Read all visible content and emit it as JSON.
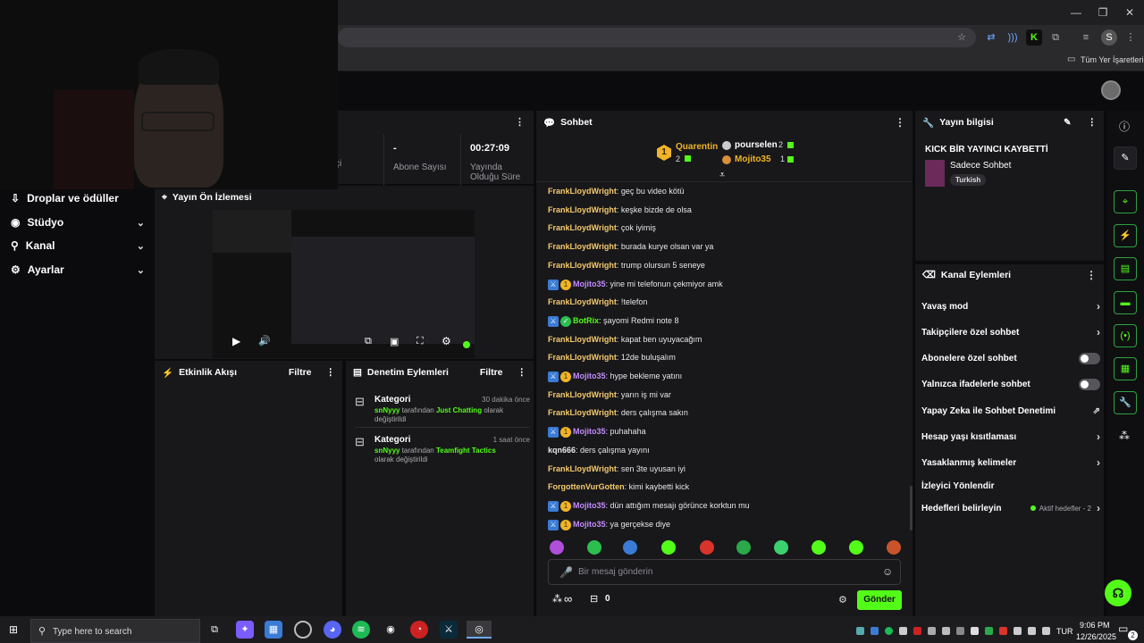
{
  "browser": {
    "bookmarks_label": "Tüm Yer İşaretleri",
    "profile_letter": "S",
    "colors": {
      "bg": "#1f1f22",
      "toolbar": "#2a2a2d"
    }
  },
  "nav": {
    "items": [
      {
        "label": "Droplar ve ödüller",
        "icon": "gift-icon"
      },
      {
        "label": "Stüdyo",
        "icon": "camera-icon"
      },
      {
        "label": "Kanal",
        "icon": "chart-icon"
      },
      {
        "label": "Ayarlar",
        "icon": "gear-icon"
      }
    ]
  },
  "stats": {
    "partial_label": "çi",
    "subs_value": "-",
    "subs_label": "Abone Sayısı",
    "uptime_value": "00:27:09",
    "uptime_label": "Yayında Olduğu Süre"
  },
  "preview": {
    "title": "Yayın Ön İzlemesi"
  },
  "activity": {
    "title": "Etkinlik Akışı",
    "filter": "Filtre"
  },
  "moderation": {
    "title": "Denetim Eylemleri",
    "filter": "Filtre",
    "events": [
      {
        "type": "Kategori",
        "time": "30 dakika önce",
        "user": "snNyyy",
        "middle": "tarafından",
        "category": "Just Chatting",
        "suffix": "olarak değiştirildi"
      },
      {
        "type": "Kategori",
        "time": "1 saat önce",
        "user": "snNyyy",
        "middle": "tarafından",
        "category": "Teamfight Tactics",
        "suffix": "olarak değiştirildi"
      }
    ]
  },
  "chat": {
    "title": "Sohbet",
    "leaders": [
      {
        "rank": "1",
        "name": "Quarentin",
        "count": "2"
      },
      {
        "name": "pourselen",
        "count": "2"
      },
      {
        "name": "Mojito35",
        "count": "1"
      }
    ],
    "messages": [
      {
        "user": "FrankLloydWright",
        "text": "geç bu video kötü",
        "color": "#f5c96b",
        "badges": 0
      },
      {
        "user": "FrankLloydWright",
        "text": "keşke bizde de olsa",
        "color": "#f5c96b",
        "badges": 0
      },
      {
        "user": "FrankLloydWright",
        "text": "çok iyimiş",
        "color": "#f5c96b",
        "badges": 0
      },
      {
        "user": "FrankLloydWright",
        "text": "burada kurye olsan var ya",
        "color": "#f5c96b",
        "badges": 0
      },
      {
        "user": "FrankLloydWright",
        "text": "trump olursun 5 seneye",
        "color": "#f5c96b",
        "badges": 0
      },
      {
        "user": "Mojito35",
        "text": "yine mi telefonun çekmiyor amk",
        "color": "#c38aff",
        "badges": 2
      },
      {
        "user": "FrankLloydWright",
        "text": "!telefon",
        "color": "#f5c96b",
        "badges": 0
      },
      {
        "user": "BotRix",
        "text": "şayomi Redmi note 8",
        "color": "#53fc18",
        "badges": 3
      },
      {
        "user": "FrankLloydWright",
        "text": "kapat ben uyuyacağım",
        "color": "#f5c96b",
        "badges": 0
      },
      {
        "user": "FrankLloydWright",
        "text": "12de buluşalım",
        "color": "#f5c96b",
        "badges": 0
      },
      {
        "user": "Mojito35",
        "text": "hype bekleme yatını",
        "color": "#c38aff",
        "badges": 2
      },
      {
        "user": "FrankLloydWright",
        "text": "yarın iş mi var",
        "color": "#f5c96b",
        "badges": 0
      },
      {
        "user": "FrankLloydWright",
        "text": "ders çalışma sakın",
        "color": "#f5c96b",
        "badges": 0
      },
      {
        "user": "Mojito35",
        "text": "puhahaha",
        "color": "#c38aff",
        "badges": 2
      },
      {
        "user": "kqn666",
        "text": "ders çalışma yayını",
        "color": "#e8e8ea",
        "badges": 0
      },
      {
        "user": "FrankLloydWright",
        "text": "sen 3te uyusan iyi",
        "color": "#f5c96b",
        "badges": 0
      },
      {
        "user": "ForgottenVurGotten",
        "text": "kimi kaybetti kick",
        "color": "#f5c96b",
        "badges": 0
      },
      {
        "user": "Mojito35",
        "text": "dün attığım mesajı görünce korktun mu",
        "color": "#c38aff",
        "badges": 2
      },
      {
        "user": "Mojito35",
        "text": "ya gerçekse diye",
        "color": "#c38aff",
        "badges": 2
      }
    ],
    "input_placeholder": "Bir mesaj gönderin",
    "points_value": "0",
    "send_label": "Gönder",
    "infinity": "∞"
  },
  "stream_info": {
    "header": "Yayın bilgisi",
    "title": "KICK BİR YAYINCI KAYBETTİ",
    "category": "Sadece Sohbet",
    "tag": "Turkish"
  },
  "channel_actions": {
    "header": "Kanal Eylemleri",
    "items": [
      {
        "label": "Yavaş mod",
        "kind": "chevron"
      },
      {
        "label": "Takipçilere özel sohbet",
        "kind": "chevron"
      },
      {
        "label": "Abonelere özel sohbet",
        "kind": "toggle"
      },
      {
        "label": "Yalnızca ifadelerle sohbet",
        "kind": "toggle"
      },
      {
        "label": "Yapay Zeka ile Sohbet Denetimi",
        "kind": "external"
      },
      {
        "label": "Hesap yaşı kısıtlaması",
        "kind": "chevron"
      },
      {
        "label": "Yasaklanmış kelimeler",
        "kind": "chevron"
      },
      {
        "label": "İzleyici Yönlendir",
        "kind": "none"
      },
      {
        "label": "Hedefleri belirleyin",
        "kind": "goals"
      }
    ],
    "goals_status": "Aktif hedefler - 2"
  },
  "taskbar": {
    "search_placeholder": "Type here to search",
    "lang": "TUR",
    "time": "9:06 PM",
    "date": "12/26/2025",
    "notif_count": "2"
  },
  "accent_color": "#53fc18"
}
